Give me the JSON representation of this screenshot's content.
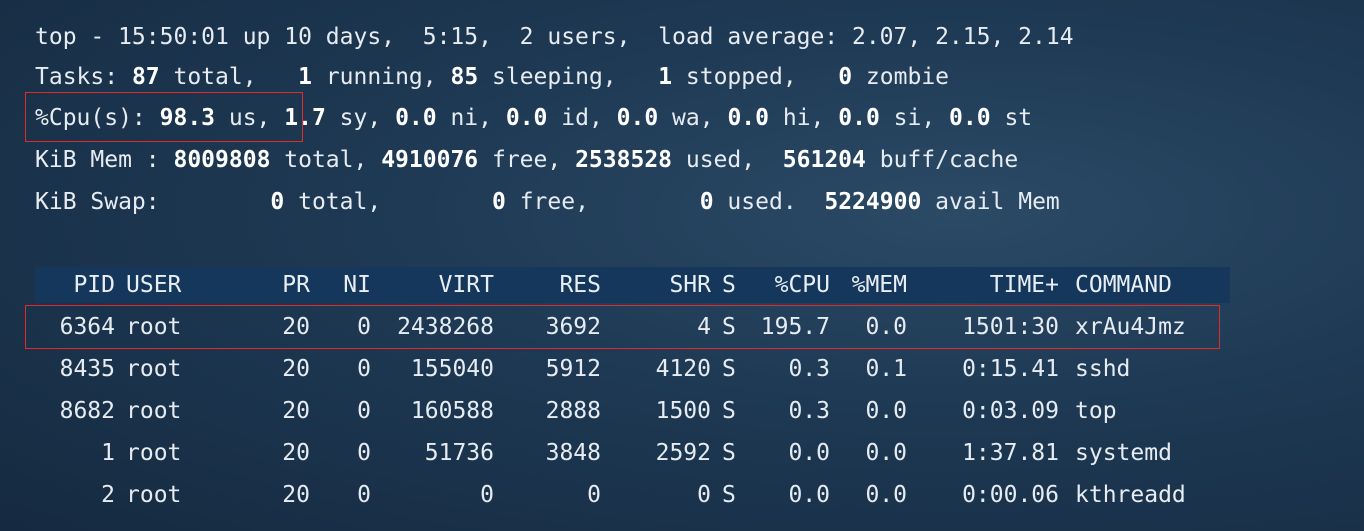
{
  "summary": {
    "l1": "top - 15:50:01 up 10 days,  5:15,  2 users,  load average: 2.07, 2.15, 2.14",
    "tasks": {
      "label": "Tasks: ",
      "total": "87",
      "total_s": " total,   ",
      "running": "1",
      "running_s": " running, ",
      "sleeping": "85",
      "sleeping_s": " sleeping,   ",
      "stopped": "1",
      "stopped_s": " stopped,   ",
      "zombie": "0",
      "zombie_s": " zombie"
    },
    "cpu": {
      "label": "%Cpu(s): ",
      "us": "98.3",
      "us_s": " us, ",
      "sy": "1.7",
      "sy_s": " sy, ",
      "ni": "0.0",
      "ni_s": " ni, ",
      "id": "0.0",
      "id_s": " id, ",
      "wa": "0.0",
      "wa_s": " wa, ",
      "hi": "0.0",
      "hi_s": " hi, ",
      "si": "0.0",
      "si_s": " si, ",
      "st": "0.0",
      "st_s": " st"
    },
    "mem": {
      "label": "KiB Mem : ",
      "total": "8009808",
      "total_s": " total, ",
      "free": "4910076",
      "free_s": " free, ",
      "used": "2538528",
      "used_s": " used,  ",
      "buff": "561204",
      "buff_s": " buff/cache"
    },
    "swap": {
      "label": "KiB Swap:        ",
      "total": "0",
      "total_s": " total,        ",
      "free": "0",
      "free_s": " free,        ",
      "used": "0",
      "used_s": " used.  ",
      "avail": "5224900",
      "avail_s": " avail Mem"
    }
  },
  "columns": [
    "PID",
    "USER",
    "PR",
    "NI",
    "VIRT",
    "RES",
    "SHR",
    "S",
    "%CPU",
    "%MEM",
    "TIME+",
    "COMMAND"
  ],
  "processes": [
    {
      "pid": "6364",
      "user": "root",
      "pr": "20",
      "ni": "0",
      "virt": "2438268",
      "res": "3692",
      "shr": "4",
      "s": "S",
      "cpu": "195.7",
      "mem": "0.0",
      "time": "1501:30",
      "cmd": "xrAu4Jmz"
    },
    {
      "pid": "8435",
      "user": "root",
      "pr": "20",
      "ni": "0",
      "virt": "155040",
      "res": "5912",
      "shr": "4120",
      "s": "S",
      "cpu": "0.3",
      "mem": "0.1",
      "time": "0:15.41",
      "cmd": "sshd"
    },
    {
      "pid": "8682",
      "user": "root",
      "pr": "20",
      "ni": "0",
      "virt": "160588",
      "res": "2888",
      "shr": "1500",
      "s": "S",
      "cpu": "0.3",
      "mem": "0.0",
      "time": "0:03.09",
      "cmd": "top"
    },
    {
      "pid": "1",
      "user": "root",
      "pr": "20",
      "ni": "0",
      "virt": "51736",
      "res": "3848",
      "shr": "2592",
      "s": "S",
      "cpu": "0.0",
      "mem": "0.0",
      "time": "1:37.81",
      "cmd": "systemd"
    },
    {
      "pid": "2",
      "user": "root",
      "pr": "20",
      "ni": "0",
      "virt": "0",
      "res": "0",
      "shr": "0",
      "s": "S",
      "cpu": "0.0",
      "mem": "0.0",
      "time": "0:00.06",
      "cmd": "kthreadd"
    }
  ],
  "colors": {
    "background": "#1f3a55",
    "header_bar": "#16375c",
    "highlight_border": "#e02b2b"
  }
}
